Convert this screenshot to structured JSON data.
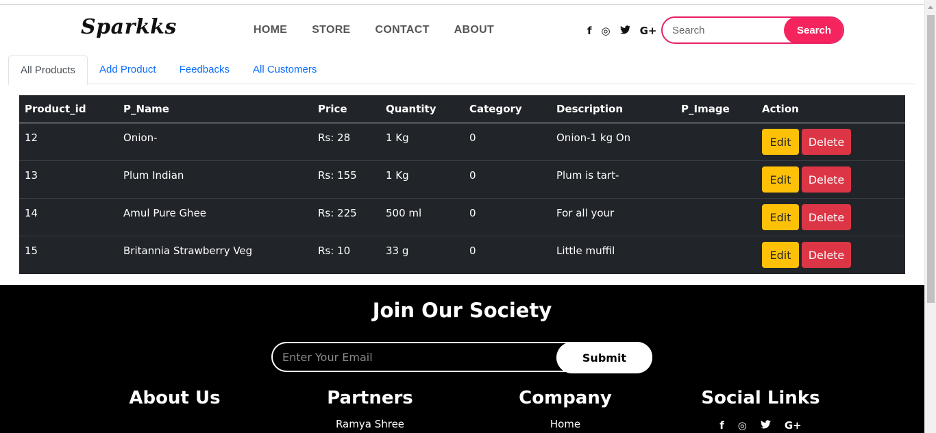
{
  "brand": {
    "logo": "Sparkks"
  },
  "nav": [
    "HOME",
    "STORE",
    "CONTACT",
    "ABOUT"
  ],
  "social_icons": [
    "facebook-icon",
    "instagram-icon",
    "twitter-icon",
    "google-plus-icon"
  ],
  "social_glyphs": [
    "f",
    "◎",
    "🐦",
    "G+"
  ],
  "search": {
    "placeholder": "Search",
    "button": "Search"
  },
  "tabs": [
    "All Products",
    "Add Product",
    "Feedbacks",
    "All Customers"
  ],
  "table": {
    "headers": [
      "Product_id",
      "P_Name",
      "Price",
      "Quantity",
      "Category",
      "Description",
      "P_Image",
      "Action"
    ],
    "rows": [
      {
        "id": "12",
        "name": "Onion-",
        "price": "Rs: 28",
        "qty": "1 Kg",
        "category": "0",
        "desc": "Onion-1 kg On",
        "image": ""
      },
      {
        "id": "13",
        "name": "Plum Indian",
        "price": "Rs: 155",
        "qty": "1 Kg",
        "category": "0",
        "desc": "Plum is tart-",
        "image": ""
      },
      {
        "id": "14",
        "name": "Amul Pure Ghee",
        "price": "Rs: 225",
        "qty": "500 ml",
        "category": "0",
        "desc": "For all your",
        "image": ""
      },
      {
        "id": "15",
        "name": "Britannia Strawberry Veg",
        "price": "Rs: 10",
        "qty": "33 g",
        "category": "0",
        "desc": "Little muffil",
        "image": ""
      }
    ],
    "edit_label": "Edit",
    "delete_label": "Delete"
  },
  "footer": {
    "title": "Join Our Society",
    "email_placeholder": "Enter Your Email",
    "submit": "Submit",
    "columns": [
      {
        "heading": "About Us",
        "link": ""
      },
      {
        "heading": "Partners",
        "link": "Ramya Shree"
      },
      {
        "heading": "Company",
        "link": "Home"
      },
      {
        "heading": "Social Links",
        "link": ""
      }
    ]
  },
  "colors": {
    "accent": "#f5245f",
    "table_bg": "#212529",
    "edit": "#ffc107",
    "delete": "#dc3545"
  }
}
